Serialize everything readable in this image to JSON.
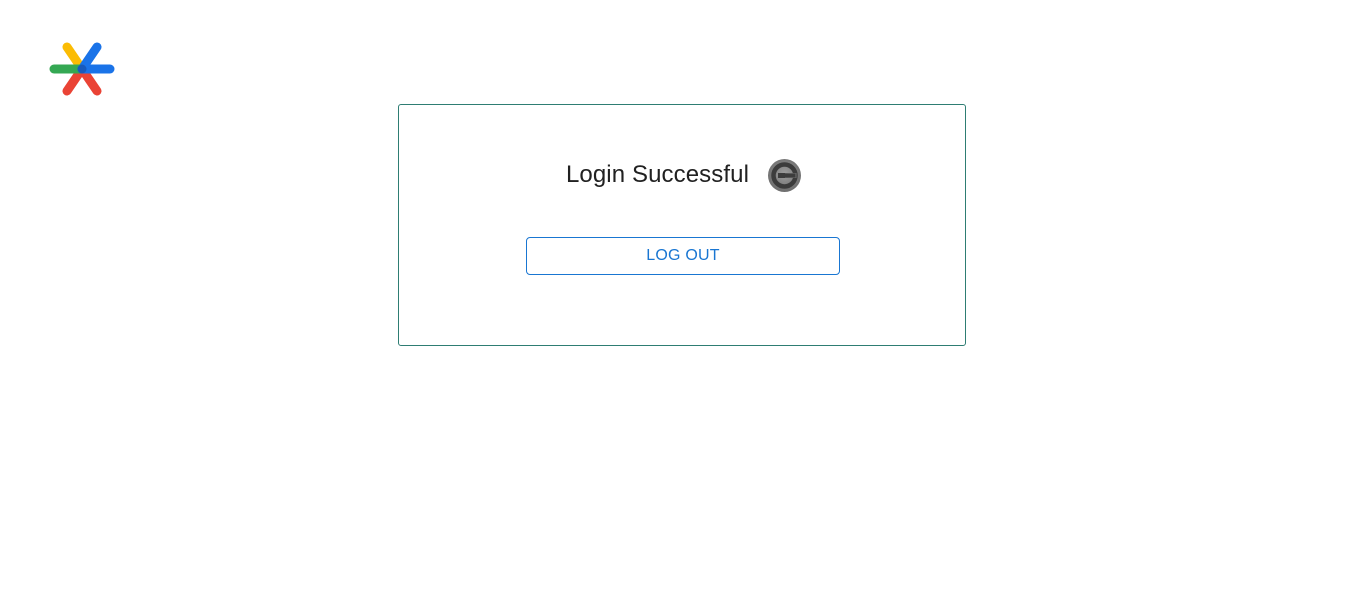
{
  "logo": {
    "icon": "google-authenticator-asterisk-logo",
    "colors": {
      "yellow": "#fbbc04",
      "blue": "#1a73e8",
      "green": "#34a853",
      "red": "#ea4335"
    }
  },
  "card": {
    "title": "Login Successful",
    "title_icon": "google-authenticator-icon",
    "border_color": "#2e7d73",
    "logout_label": "LOG OUT",
    "button_color": "#1976d2"
  }
}
